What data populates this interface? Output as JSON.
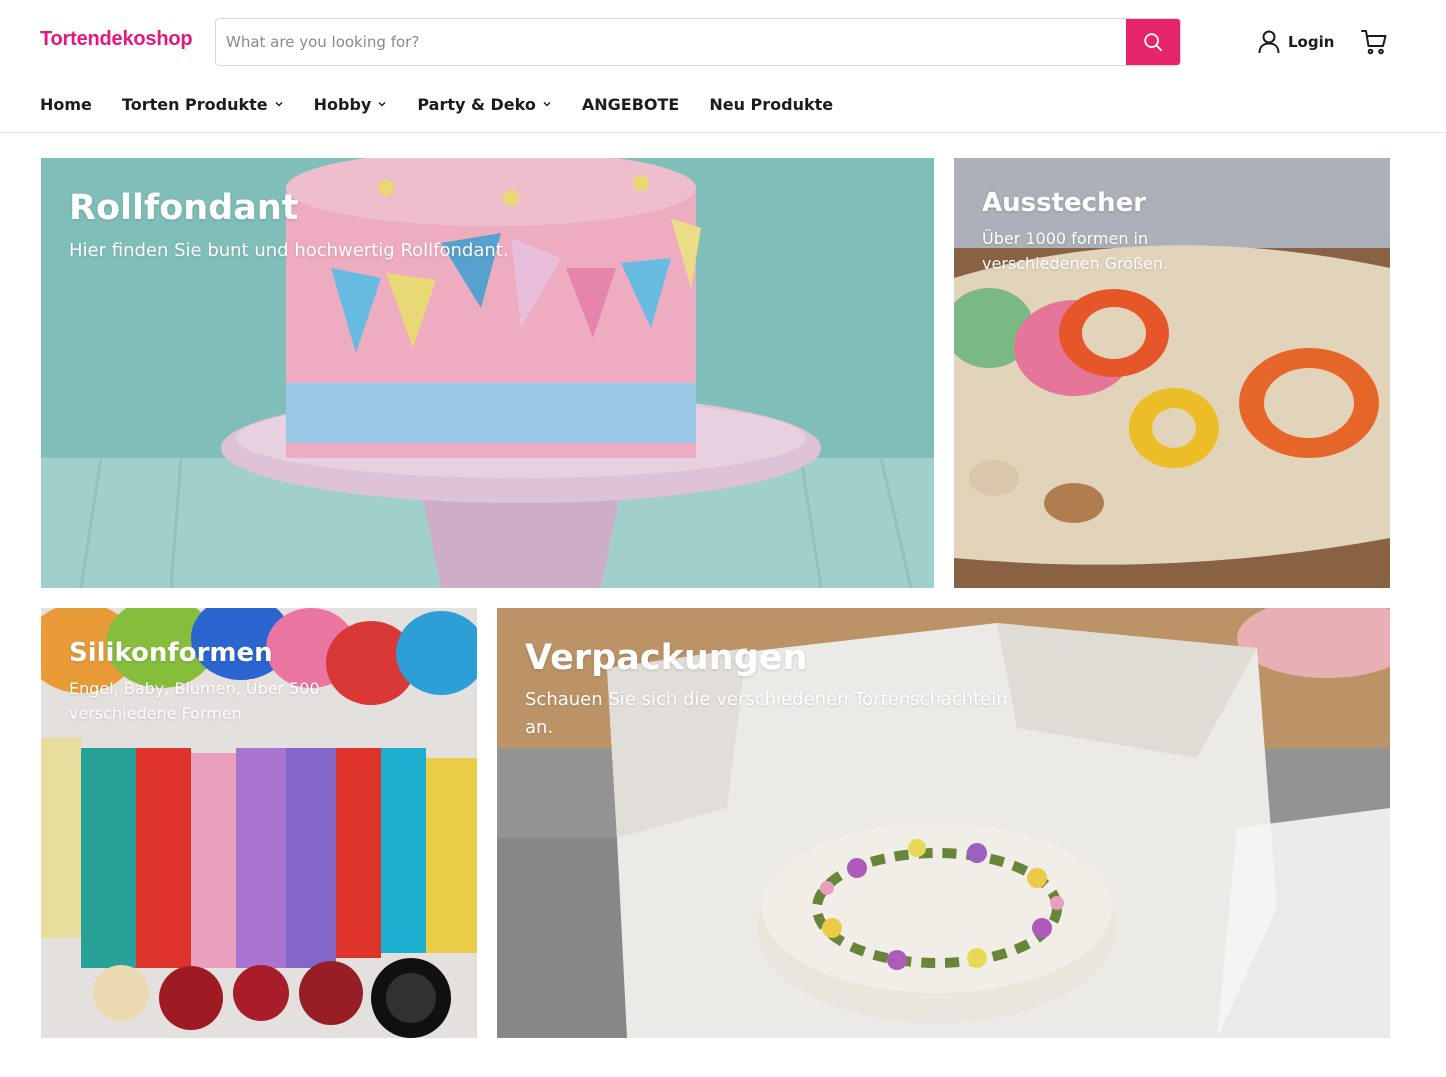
{
  "header": {
    "logo": "Tortendekoshop",
    "search": {
      "placeholder": "What are you looking for?"
    },
    "login_label": "Login",
    "accent_color": "#e5246c",
    "logo_color": "#e6177d"
  },
  "nav": {
    "items": [
      {
        "label": "Home",
        "has_dropdown": false
      },
      {
        "label": "Torten Produkte",
        "has_dropdown": true
      },
      {
        "label": "Hobby",
        "has_dropdown": true
      },
      {
        "label": "Party & Deko",
        "has_dropdown": true
      },
      {
        "label": "ANGEBOTE",
        "has_dropdown": false
      },
      {
        "label": "Neu Produkte",
        "has_dropdown": false
      }
    ]
  },
  "tiles": [
    {
      "title": "Rollfondant",
      "description": "Hier finden Sie bunt und hochwertig Rollfondant.",
      "image_icon": "fondant-cake-image"
    },
    {
      "title": "Ausstecher",
      "description": "Über 1000 formen in verschiedenen Größen.",
      "image_icon": "cookie-cutters-image"
    },
    {
      "title": "Silikonformen",
      "description": "Engel, Baby, Blumen, Über 500 verschiedene Formen",
      "image_icon": "silicone-molds-image"
    },
    {
      "title": "Verpackungen",
      "description": "Schauen Sie sich die verschiedenen Tortenschachteln an.",
      "image_icon": "cake-box-image"
    }
  ]
}
